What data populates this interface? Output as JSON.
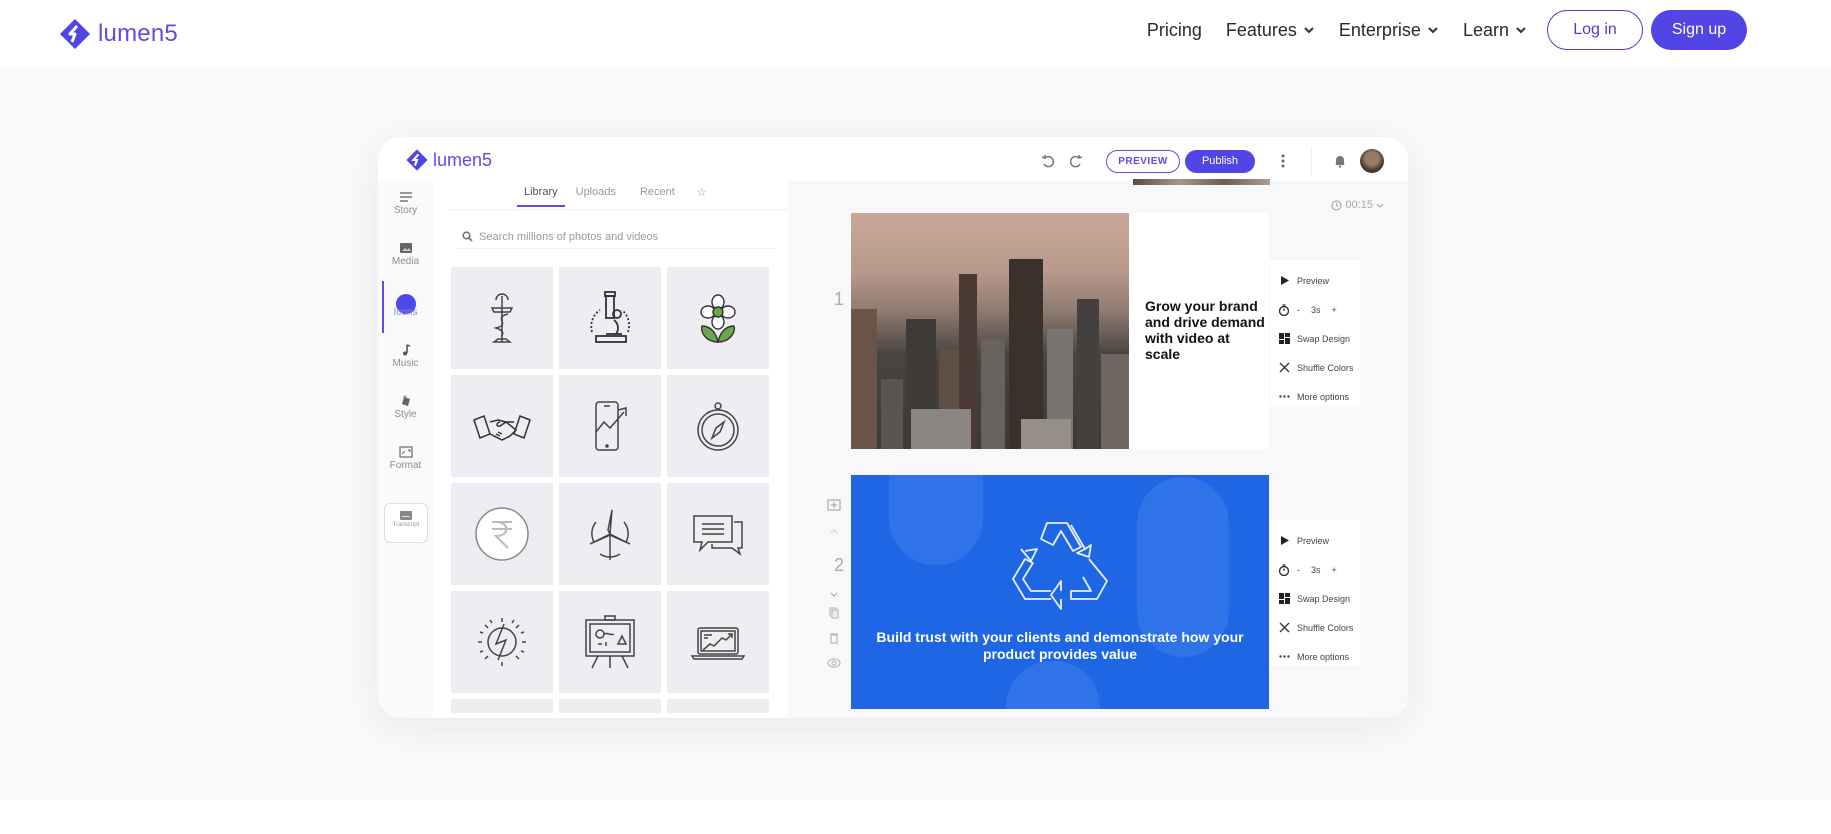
{
  "site": {
    "brand": "lumen5",
    "brand_color": "#5146e5",
    "nav": [
      {
        "label": "Pricing",
        "has_dropdown": false
      },
      {
        "label": "Features",
        "has_dropdown": true
      },
      {
        "label": "Enterprise",
        "has_dropdown": true
      },
      {
        "label": "Learn",
        "has_dropdown": true
      }
    ],
    "login_label": "Log in",
    "signup_label": "Sign up"
  },
  "app": {
    "brand": "lumen5",
    "toolbar": {
      "undo_icon": "undo-icon",
      "redo_icon": "redo-icon",
      "preview_label": "PREVIEW",
      "publish_label": "Publish",
      "more_icon": "kebab-icon",
      "notifications_icon": "bell-icon",
      "avatar": "user-avatar"
    },
    "rail": [
      {
        "label": "Story",
        "icon": "story-icon"
      },
      {
        "label": "Media",
        "icon": "media-icon"
      },
      {
        "label": "Icons",
        "icon": "icons-icon",
        "active": true
      },
      {
        "label": "Music",
        "icon": "music-icon"
      },
      {
        "label": "Style",
        "icon": "style-icon"
      },
      {
        "label": "Format",
        "icon": "format-icon"
      }
    ],
    "transcript_label": "Transcript",
    "tabs": [
      {
        "label": "Library",
        "active": true
      },
      {
        "label": "Uploads"
      },
      {
        "label": "Recent"
      },
      {
        "label": "☆"
      }
    ],
    "search_placeholder": "Search millions of photos and videos",
    "icon_tiles": [
      "caduceus-icon",
      "microscope-icon",
      "flower-icon",
      "handshake-icon",
      "phone-growth-icon",
      "compass-icon",
      "rupee-icon",
      "wind-turbine-icon",
      "chat-bubbles-icon",
      "solar-energy-icon",
      "presentation-board-icon",
      "laptop-chart-icon"
    ],
    "duration": "00:15",
    "scenes": [
      {
        "number": "1",
        "text": "Grow your brand and drive demand with video at scale",
        "tools": {
          "preview": "Preview",
          "minus": "-",
          "duration": "3s",
          "plus": "+",
          "swap": "Swap Design",
          "shuffle": "Shuffle Colors",
          "more": "More options"
        }
      },
      {
        "number": "2",
        "text": "Build trust with your clients and demonstrate how your product provides value",
        "bg_color": "#1f66e5",
        "tools": {
          "preview": "Preview",
          "minus": "-",
          "duration": "3s",
          "plus": "+",
          "swap": "Swap Design",
          "shuffle": "Shuffle Colors",
          "more": "More options"
        }
      }
    ]
  }
}
